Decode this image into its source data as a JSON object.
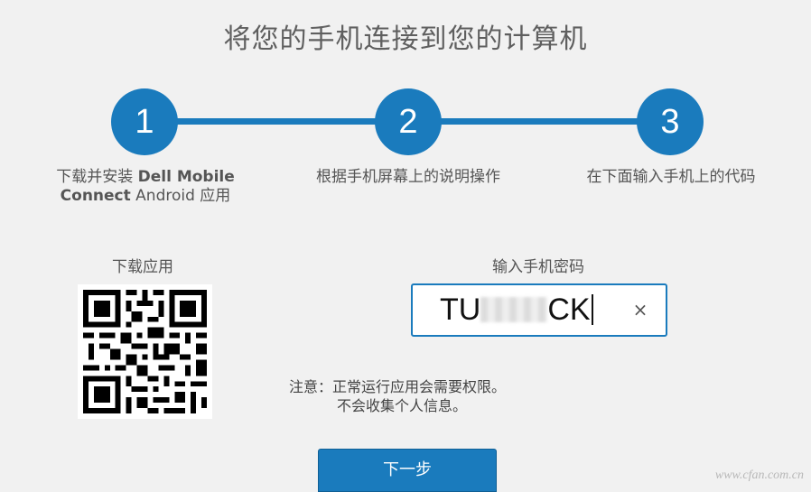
{
  "title": "将您的手机连接到您的计算机",
  "steps": [
    {
      "number": "1",
      "caption_line1_prefix": "下载并安装 ",
      "caption_line1_bold": "Dell Mobile",
      "caption_line2_bold": "Connect",
      "caption_line2_rest": " Android 应用"
    },
    {
      "number": "2",
      "caption": "根据手机屏幕上的说明操作"
    },
    {
      "number": "3",
      "caption": "在下面输入手机上的代码"
    }
  ],
  "download": {
    "label": "下载应用",
    "qr_icon": "qr-code-icon"
  },
  "password": {
    "label": "输入手机密码",
    "value_prefix": "TU",
    "value_suffix": "CK",
    "clear_icon": "×"
  },
  "note": {
    "line1": "注意：正常运行应用会需要权限。",
    "line2": "不会收集个人信息。"
  },
  "next_button": "下一步",
  "watermark": "www.cfan.com.cn",
  "colors": {
    "accent": "#1a7bbd",
    "background": "#f1f1f1"
  }
}
